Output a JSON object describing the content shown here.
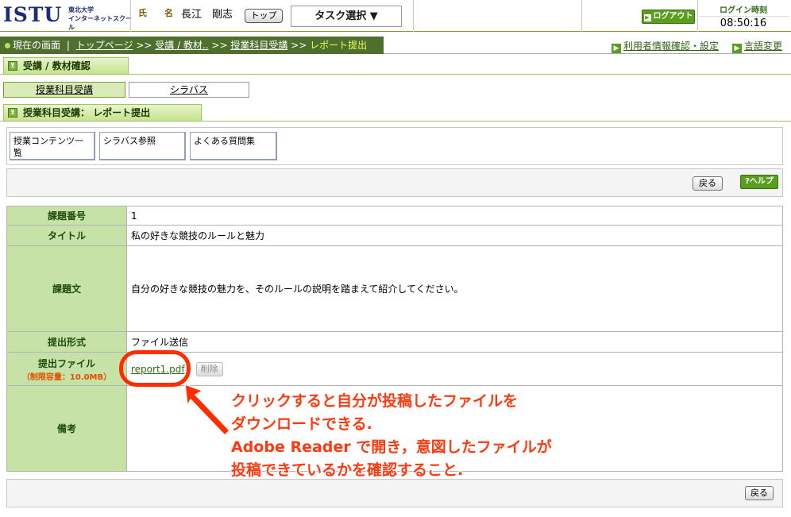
{
  "header": {
    "logo_main": "ISTU",
    "logo_sub_line1": "東北大学",
    "logo_sub_line2": "インターネットスクール",
    "user_label": "氏　　名",
    "user_name": "長江　剛志",
    "top_button": "トップ",
    "task_select": "タスク選択 ▼",
    "logout_button": "ログアウト",
    "login_time_label": "ログイン時刻",
    "login_time_value": "08:50:16"
  },
  "breadcrumb": {
    "items": [
      "現在の画面",
      "トップページ",
      "受講 / 教材..",
      "授業科目受講",
      "レポート提出"
    ],
    "sep": ">>"
  },
  "top_links": {
    "user_info": "利用者情報確認・設定",
    "language": "言語変更"
  },
  "section1": {
    "title": "受講 / 教材確認"
  },
  "tabs": [
    "授業科目受講",
    "シラバス"
  ],
  "section2": {
    "title": "授業科目受講： レポート提出"
  },
  "sub_buttons": [
    "授業コンテンツ一覧",
    "シラバス参照",
    "よくある質問集"
  ],
  "toolbar": {
    "back": "戻る",
    "help": "?ヘルプ"
  },
  "form": {
    "rows": [
      {
        "label": "課題番号",
        "value": "1"
      },
      {
        "label": "タイトル",
        "value": "私の好きな競技のルールと魅力"
      },
      {
        "label": "課題文",
        "value": "自分の好きな競技の魅力を、そのルールの説明を踏まえて紹介してください。"
      },
      {
        "label": "提出形式",
        "value": "ファイル送信"
      },
      {
        "label": "提出ファイル",
        "sublabel": "（制限容量：10.0MB）",
        "file_link": "report1.pdf",
        "delete_button": "削除"
      },
      {
        "label": "備考",
        "value": ""
      }
    ]
  },
  "bottom": {
    "back": "戻る"
  },
  "annotation": {
    "lines": [
      "クリックすると自分が投稿したファイルを",
      "ダウンロードできる.",
      "Adobe Reader で開き，意図したファイルが",
      "投稿できているかを確認すること."
    ]
  },
  "colors": {
    "accent_green": "#4f6f2f",
    "label_bg": "#c7e2a6",
    "annotation_red": "#ff2d00"
  }
}
